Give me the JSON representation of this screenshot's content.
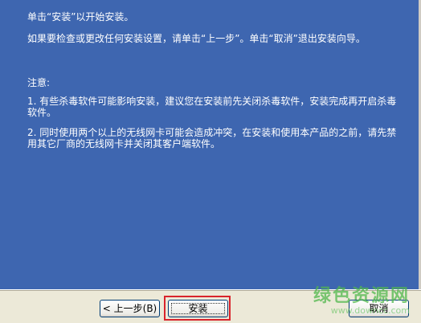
{
  "content": {
    "line1": "单击“安装”以开始安装。",
    "line2": "如果要检查或更改任何安装设置，请单击“上一步”。单击“取消”退出安装向导。",
    "note_title": "注意:",
    "note1": "1. 有些杀毒软件可能影响安装，建议您在安装前先关闭杀毒软件，安装完成再开启杀毒软件。",
    "note2": "2. 同时使用两个以上的无线网卡可能会造成冲突，在安装和使用本产品的之前，请先禁用其它厂商的无线网卡并关闭其客户端软件。"
  },
  "buttons": {
    "back": "< 上一步(B)",
    "install": "安装",
    "cancel": "取消"
  },
  "watermark": {
    "main": "绿色资源网",
    "sub": "www.downcc.com"
  },
  "colors": {
    "background": "#3e66b0",
    "highlight": "#d9242c",
    "watermark": "#51b84d"
  }
}
